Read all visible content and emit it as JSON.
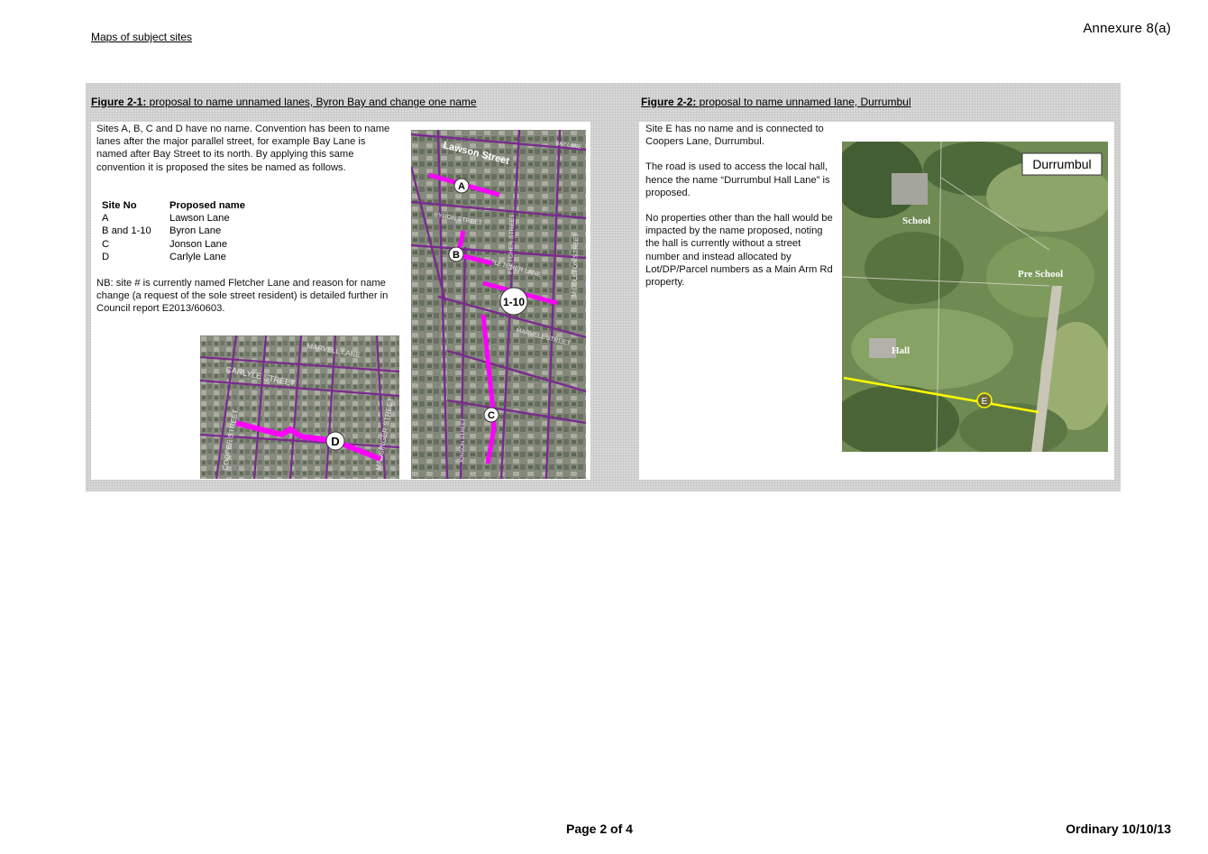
{
  "header": {
    "left": "Maps of subject sites",
    "right": "Annexure 8(a)"
  },
  "figure1": {
    "label": "Figure 2-1:",
    "caption": " proposal to name unnamed lanes, Byron Bay and change one name",
    "intro": "Sites A, B, C and D have no name. Convention has been to name lanes after the major parallel street, for example Bay Lane is named after Bay Street to its north. By applying this same convention it is proposed the sites be named as follows.",
    "table": {
      "headers": [
        "Site No",
        "Proposed name"
      ],
      "rows": [
        [
          "A",
          "Lawson Lane"
        ],
        [
          "B and 1-10",
          "Byron Lane"
        ],
        [
          "C",
          "Jonson Lane"
        ],
        [
          "D",
          "Carlyle Lane"
        ]
      ]
    },
    "note": "NB: site # is currently named Fletcher Lane and reason for name change (a request of the sole street resident) is detailed further in Council report E2013/60603.",
    "map_small": {
      "street_labels": [
        "CARLYLE STREET",
        "MARVELL LANE",
        "COOPER STREET",
        "MASSINGER STREET"
      ],
      "marker": "D"
    },
    "map_tall": {
      "street_labels": [
        "Lawson Street",
        "BYRON STREET",
        "FLETCHER STREET",
        "FLETCHER LANE",
        "MARVELL STREET",
        "MIDDLETON STREET",
        "JONSON STREET",
        "BAY LANE"
      ],
      "markers": [
        "A",
        "B",
        "1-10",
        "C"
      ]
    },
    "colors": {
      "highlight": "#ff00ff",
      "road": "#7a2b8f"
    }
  },
  "figure2": {
    "label": "Figure 2-2:",
    "caption": " proposal to name unnamed lane, Durrumbul",
    "paragraphs": [
      "Site E has no name and is connected to Coopers Lane, Durrumbul.",
      "The road is used to access the local hall, hence the name “Durrumbul Hall Lane” is proposed.",
      "No properties other than the hall would be impacted by the name proposed, noting the hall is currently without a street number and instead allocated by Lot/DP/Parcel numbers as a Main Arm Rd property."
    ],
    "map": {
      "title": "Durrumbul",
      "labels": [
        "School",
        "Pre School",
        "Hall"
      ],
      "marker": "E",
      "colors": {
        "highlight": "#ffff00"
      }
    }
  },
  "footer": {
    "center": "Page 2 of 4",
    "right": "Ordinary 10/10/13"
  }
}
